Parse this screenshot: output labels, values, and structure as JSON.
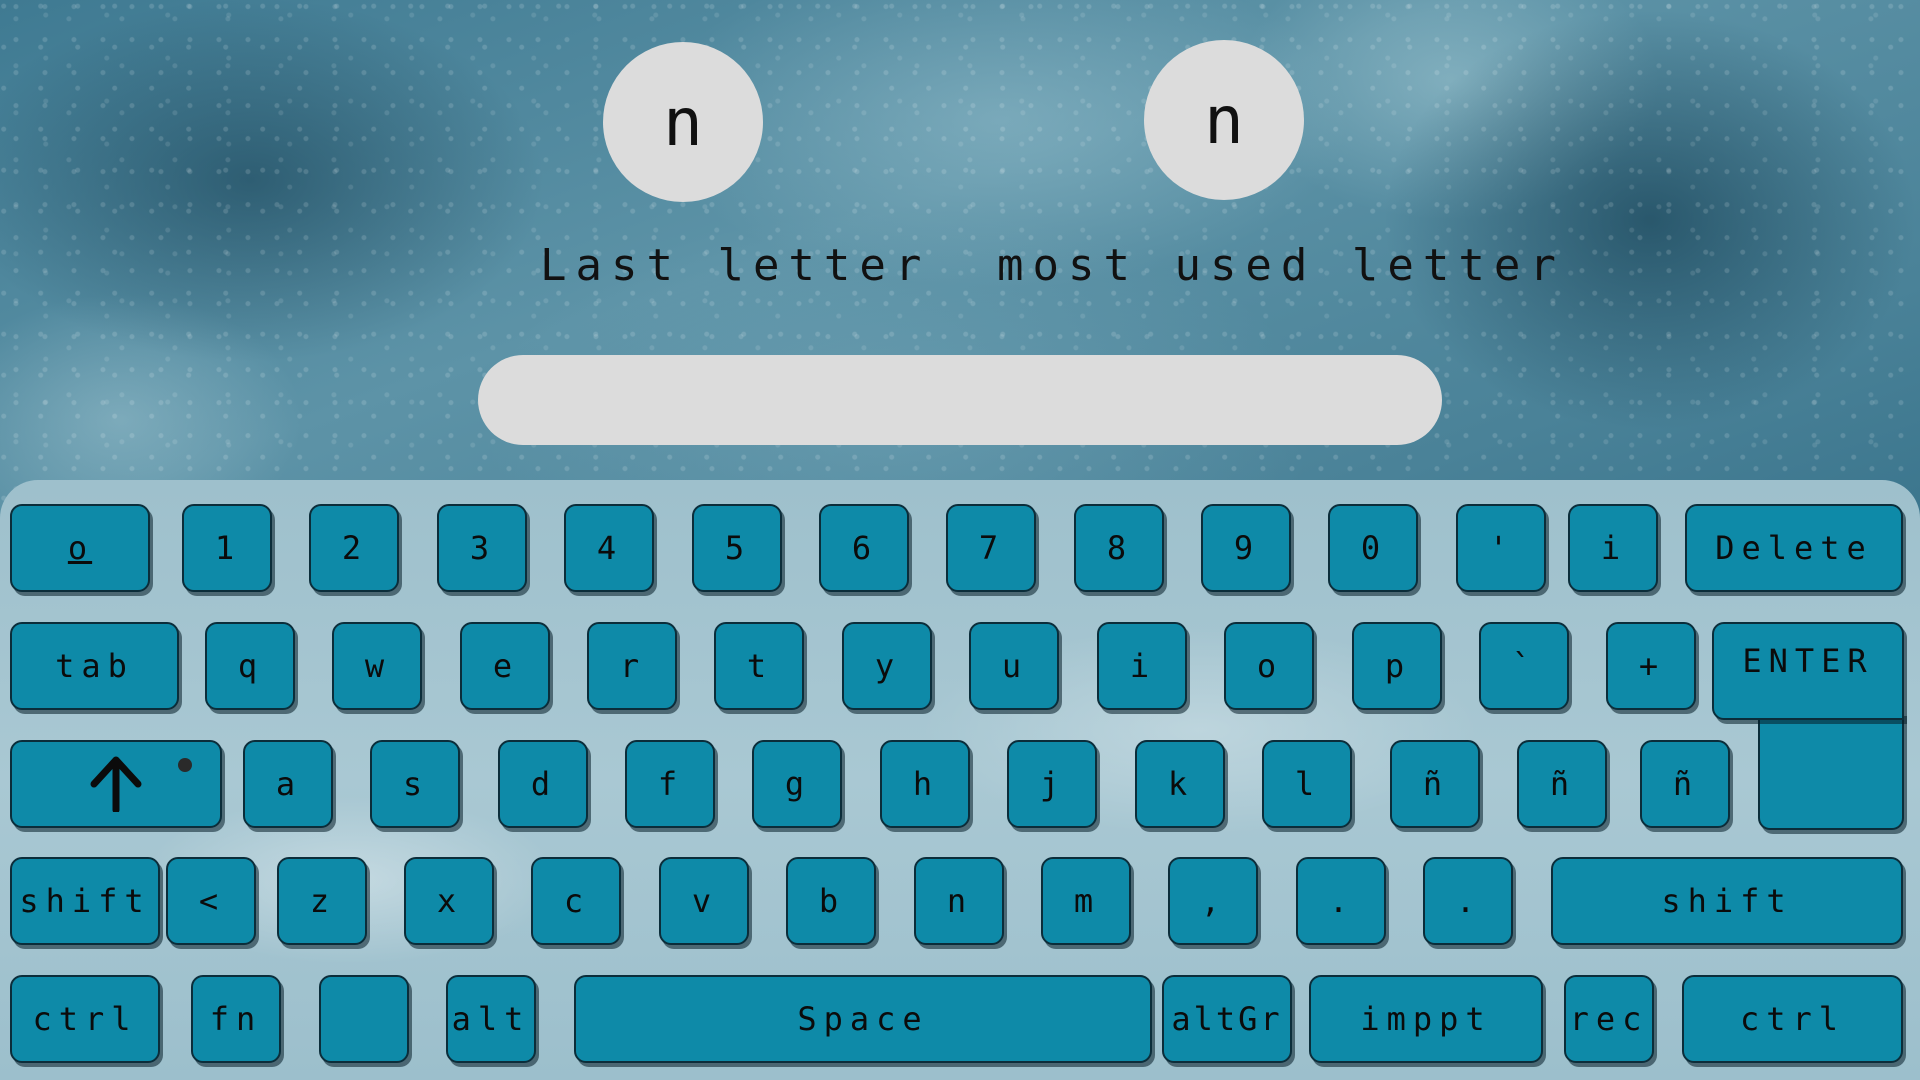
{
  "indicators": {
    "last_letter": {
      "value": "n",
      "caption": "Last letter"
    },
    "most_used_letter": {
      "value": "n",
      "caption": "most used letter"
    }
  },
  "text_field": {
    "value": ""
  },
  "keyboard": {
    "rows": [
      [
        "o",
        "1",
        "2",
        "3",
        "4",
        "5",
        "6",
        "7",
        "8",
        "9",
        "0",
        "'",
        "i",
        "Delete"
      ],
      [
        "tab",
        "q",
        "w",
        "e",
        "r",
        "t",
        "y",
        "u",
        "i",
        "o",
        "p",
        "`",
        "+",
        "ENTER"
      ],
      [
        "shift-lock-arrow-icon",
        "a",
        "s",
        "d",
        "f",
        "g",
        "h",
        "j",
        "k",
        "l",
        "ñ",
        "ñ",
        "ñ"
      ],
      [
        "shift",
        "<",
        "z",
        "x",
        "c",
        "v",
        "b",
        "n",
        "m",
        ",",
        ".",
        ".",
        "shift"
      ],
      [
        "ctrl",
        "fn",
        "",
        "alt",
        "Space",
        "altGr",
        "imppt",
        "rec",
        "ctrl"
      ]
    ],
    "key_color": "#0e8aa8",
    "caps_lock_indicator": "on"
  }
}
